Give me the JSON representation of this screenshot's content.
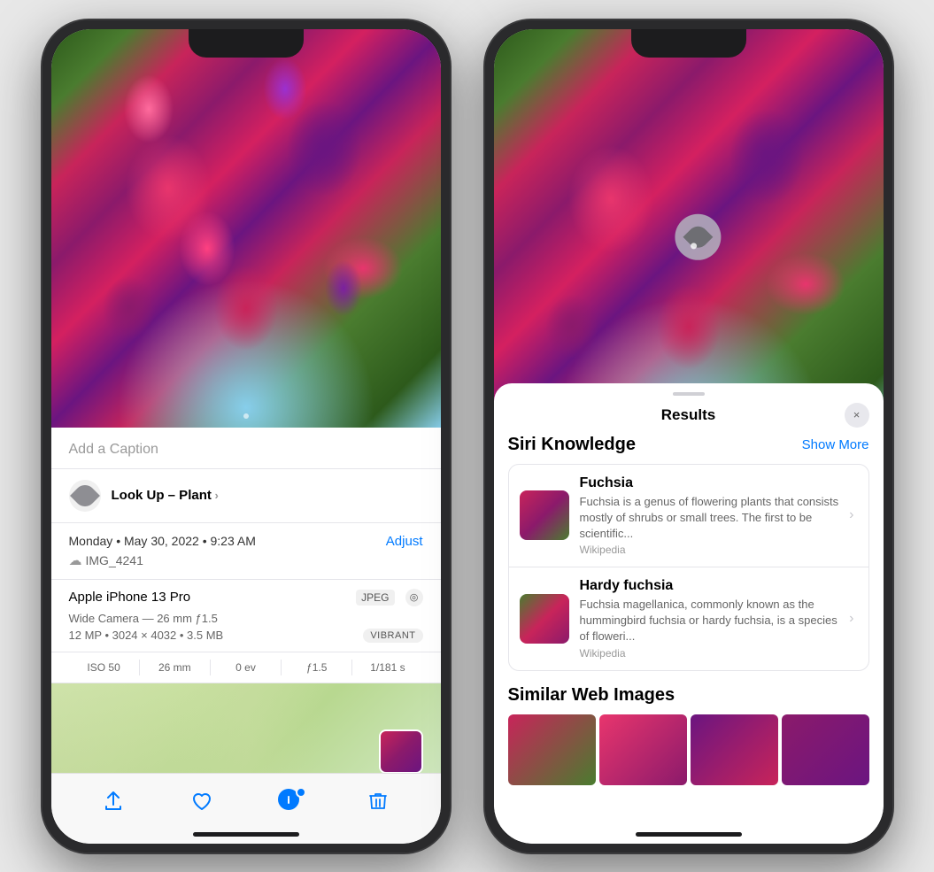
{
  "phone1": {
    "caption_placeholder": "Add a Caption",
    "lookup_label": "Look Up –",
    "lookup_subject": " Plant",
    "lookup_arrow": " ›",
    "date": "Monday • May 30, 2022 • 9:23 AM",
    "adjust_label": "Adjust",
    "filename": "IMG_4241",
    "device_name": "Apple iPhone 13 Pro",
    "format": "JPEG",
    "camera_type": "Wide Camera — 26 mm ƒ1.5",
    "resolution": "12 MP • 3024 × 4032 • 3.5 MB",
    "filter": "VIBRANT",
    "iso": "ISO 50",
    "focal": "26 mm",
    "ev": "0 ev",
    "aperture": "ƒ1.5",
    "shutter": "1/181 s",
    "toolbar": {
      "share": "↑",
      "heart": "♡",
      "info": "ⓘ",
      "trash": "🗑"
    }
  },
  "phone2": {
    "sheet": {
      "title": "Results",
      "close_label": "×",
      "siri_section": "Siri Knowledge",
      "show_more": "Show More",
      "items": [
        {
          "title": "Fuchsia",
          "description": "Fuchsia is a genus of flowering plants that consists mostly of shrubs or small trees. The first to be scientific...",
          "source": "Wikipedia"
        },
        {
          "title": "Hardy fuchsia",
          "description": "Fuchsia magellanica, commonly known as the hummingbird fuchsia or hardy fuchsia, is a species of floweri...",
          "source": "Wikipedia"
        }
      ],
      "similar_title": "Similar Web Images"
    }
  }
}
